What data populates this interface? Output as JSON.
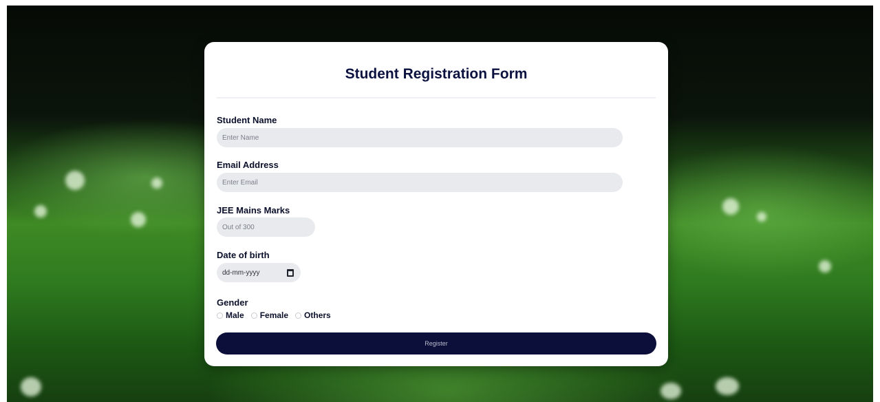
{
  "form": {
    "title": "Student Registration Form",
    "fields": {
      "name": {
        "label": "Student Name",
        "placeholder": "Enter Name"
      },
      "email": {
        "label": "Email Address",
        "placeholder": "Enter Email"
      },
      "marks": {
        "label": "JEE Mains Marks",
        "placeholder": "Out of 300"
      },
      "dob": {
        "label": "Date of birth",
        "placeholder": "dd-mm-yyyy"
      }
    },
    "gender": {
      "label": "Gender",
      "options": [
        "Male",
        "Female",
        "Others"
      ]
    },
    "submit_label": "Register"
  },
  "colors": {
    "title": "#0c1240",
    "button_bg": "#0c0f3a",
    "field_bg": "#e9eaee",
    "card_bg": "#ffffff"
  },
  "icons": {
    "date_picker": "calendar-icon"
  }
}
